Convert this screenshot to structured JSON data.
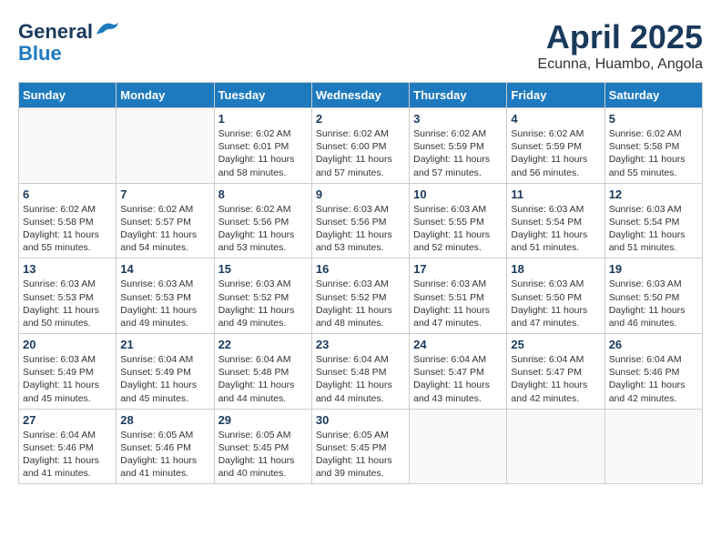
{
  "header": {
    "logo": {
      "line1": "General",
      "line2": "Blue"
    },
    "title": "April 2025",
    "location": "Ecunna, Huambo, Angola"
  },
  "days_of_week": [
    "Sunday",
    "Monday",
    "Tuesday",
    "Wednesday",
    "Thursday",
    "Friday",
    "Saturday"
  ],
  "weeks": [
    [
      {
        "day": "",
        "info": ""
      },
      {
        "day": "",
        "info": ""
      },
      {
        "day": "1",
        "info": "Sunrise: 6:02 AM\nSunset: 6:01 PM\nDaylight: 11 hours and 58 minutes."
      },
      {
        "day": "2",
        "info": "Sunrise: 6:02 AM\nSunset: 6:00 PM\nDaylight: 11 hours and 57 minutes."
      },
      {
        "day": "3",
        "info": "Sunrise: 6:02 AM\nSunset: 5:59 PM\nDaylight: 11 hours and 57 minutes."
      },
      {
        "day": "4",
        "info": "Sunrise: 6:02 AM\nSunset: 5:59 PM\nDaylight: 11 hours and 56 minutes."
      },
      {
        "day": "5",
        "info": "Sunrise: 6:02 AM\nSunset: 5:58 PM\nDaylight: 11 hours and 55 minutes."
      }
    ],
    [
      {
        "day": "6",
        "info": "Sunrise: 6:02 AM\nSunset: 5:58 PM\nDaylight: 11 hours and 55 minutes."
      },
      {
        "day": "7",
        "info": "Sunrise: 6:02 AM\nSunset: 5:57 PM\nDaylight: 11 hours and 54 minutes."
      },
      {
        "day": "8",
        "info": "Sunrise: 6:02 AM\nSunset: 5:56 PM\nDaylight: 11 hours and 53 minutes."
      },
      {
        "day": "9",
        "info": "Sunrise: 6:03 AM\nSunset: 5:56 PM\nDaylight: 11 hours and 53 minutes."
      },
      {
        "day": "10",
        "info": "Sunrise: 6:03 AM\nSunset: 5:55 PM\nDaylight: 11 hours and 52 minutes."
      },
      {
        "day": "11",
        "info": "Sunrise: 6:03 AM\nSunset: 5:54 PM\nDaylight: 11 hours and 51 minutes."
      },
      {
        "day": "12",
        "info": "Sunrise: 6:03 AM\nSunset: 5:54 PM\nDaylight: 11 hours and 51 minutes."
      }
    ],
    [
      {
        "day": "13",
        "info": "Sunrise: 6:03 AM\nSunset: 5:53 PM\nDaylight: 11 hours and 50 minutes."
      },
      {
        "day": "14",
        "info": "Sunrise: 6:03 AM\nSunset: 5:53 PM\nDaylight: 11 hours and 49 minutes."
      },
      {
        "day": "15",
        "info": "Sunrise: 6:03 AM\nSunset: 5:52 PM\nDaylight: 11 hours and 49 minutes."
      },
      {
        "day": "16",
        "info": "Sunrise: 6:03 AM\nSunset: 5:52 PM\nDaylight: 11 hours and 48 minutes."
      },
      {
        "day": "17",
        "info": "Sunrise: 6:03 AM\nSunset: 5:51 PM\nDaylight: 11 hours and 47 minutes."
      },
      {
        "day": "18",
        "info": "Sunrise: 6:03 AM\nSunset: 5:50 PM\nDaylight: 11 hours and 47 minutes."
      },
      {
        "day": "19",
        "info": "Sunrise: 6:03 AM\nSunset: 5:50 PM\nDaylight: 11 hours and 46 minutes."
      }
    ],
    [
      {
        "day": "20",
        "info": "Sunrise: 6:03 AM\nSunset: 5:49 PM\nDaylight: 11 hours and 45 minutes."
      },
      {
        "day": "21",
        "info": "Sunrise: 6:04 AM\nSunset: 5:49 PM\nDaylight: 11 hours and 45 minutes."
      },
      {
        "day": "22",
        "info": "Sunrise: 6:04 AM\nSunset: 5:48 PM\nDaylight: 11 hours and 44 minutes."
      },
      {
        "day": "23",
        "info": "Sunrise: 6:04 AM\nSunset: 5:48 PM\nDaylight: 11 hours and 44 minutes."
      },
      {
        "day": "24",
        "info": "Sunrise: 6:04 AM\nSunset: 5:47 PM\nDaylight: 11 hours and 43 minutes."
      },
      {
        "day": "25",
        "info": "Sunrise: 6:04 AM\nSunset: 5:47 PM\nDaylight: 11 hours and 42 minutes."
      },
      {
        "day": "26",
        "info": "Sunrise: 6:04 AM\nSunset: 5:46 PM\nDaylight: 11 hours and 42 minutes."
      }
    ],
    [
      {
        "day": "27",
        "info": "Sunrise: 6:04 AM\nSunset: 5:46 PM\nDaylight: 11 hours and 41 minutes."
      },
      {
        "day": "28",
        "info": "Sunrise: 6:05 AM\nSunset: 5:46 PM\nDaylight: 11 hours and 41 minutes."
      },
      {
        "day": "29",
        "info": "Sunrise: 6:05 AM\nSunset: 5:45 PM\nDaylight: 11 hours and 40 minutes."
      },
      {
        "day": "30",
        "info": "Sunrise: 6:05 AM\nSunset: 5:45 PM\nDaylight: 11 hours and 39 minutes."
      },
      {
        "day": "",
        "info": ""
      },
      {
        "day": "",
        "info": ""
      },
      {
        "day": "",
        "info": ""
      }
    ]
  ]
}
